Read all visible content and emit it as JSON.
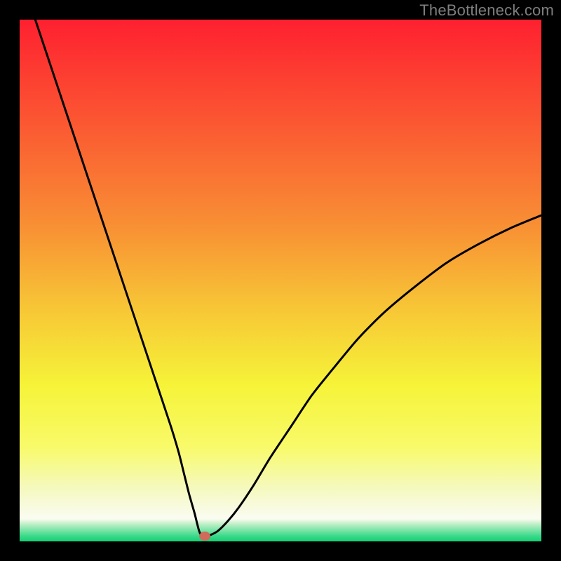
{
  "watermark": "TheBottleneck.com",
  "chart_data": {
    "type": "line",
    "title": "",
    "xlabel": "",
    "ylabel": "",
    "xlim": [
      0,
      100
    ],
    "ylim": [
      0,
      100
    ],
    "grid": false,
    "series": [
      {
        "name": "curve",
        "x": [
          3,
          6,
          10,
          14,
          18,
          22,
          26,
          29,
          30.5,
          31.5,
          32.5,
          33.5,
          34,
          34.4,
          34.8,
          35.5,
          36.5,
          38,
          40,
          42,
          45,
          48,
          52,
          56,
          60,
          65,
          70,
          76,
          82,
          88,
          94,
          100
        ],
        "y": [
          100,
          91,
          79,
          67,
          55,
          43,
          31,
          22,
          17,
          13,
          9,
          5.5,
          3.5,
          2,
          1.2,
          1,
          1.2,
          2,
          4,
          6.5,
          11,
          16,
          22,
          28,
          33,
          39,
          44,
          49,
          53.5,
          57,
          60,
          62.5
        ]
      }
    ],
    "marker": {
      "x": 35.5,
      "y": 1,
      "color": "#d06a5b"
    },
    "background_gradient": {
      "stops": [
        {
          "offset": 0.0,
          "color": "#fe2030"
        },
        {
          "offset": 0.2,
          "color": "#fb5832"
        },
        {
          "offset": 0.4,
          "color": "#f89134"
        },
        {
          "offset": 0.55,
          "color": "#f7c536"
        },
        {
          "offset": 0.7,
          "color": "#f6f338"
        },
        {
          "offset": 0.82,
          "color": "#f8fa6a"
        },
        {
          "offset": 0.9,
          "color": "#f5f9c0"
        },
        {
          "offset": 0.957,
          "color": "#fafcf2"
        },
        {
          "offset": 0.963,
          "color": "#d6f4d4"
        },
        {
          "offset": 0.975,
          "color": "#8fe8b1"
        },
        {
          "offset": 0.99,
          "color": "#3ad98a"
        },
        {
          "offset": 1.0,
          "color": "#11d274"
        }
      ]
    }
  }
}
